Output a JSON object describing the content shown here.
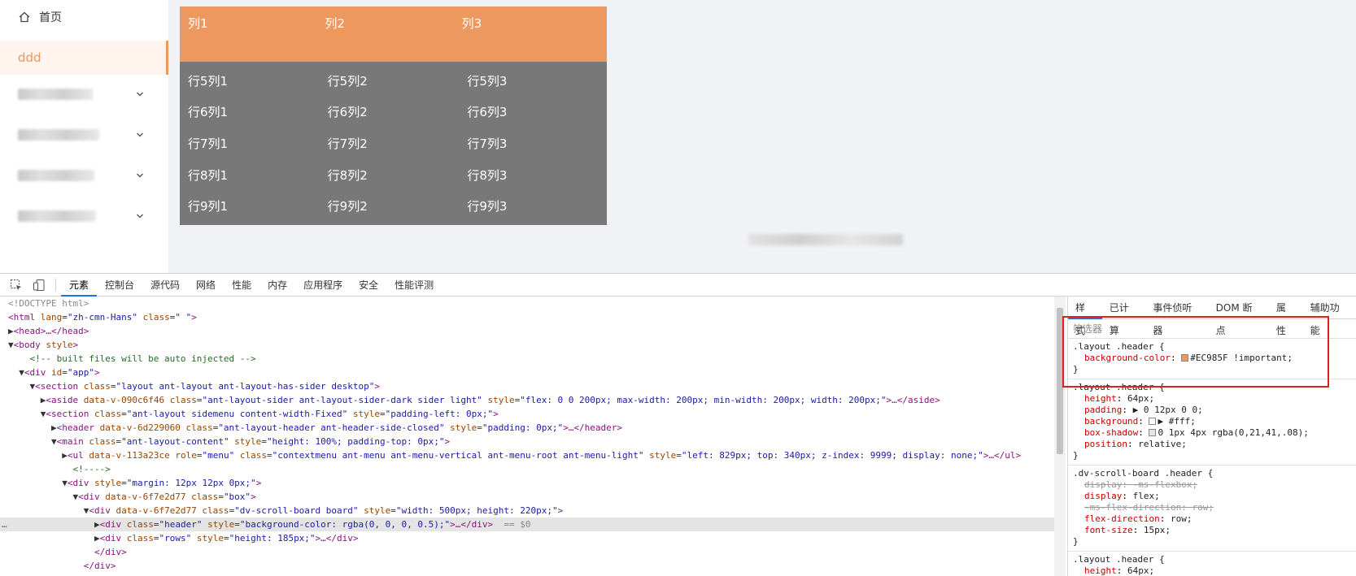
{
  "sider": {
    "home_label": "首页",
    "selected_label": "ddd",
    "submenus": [
      {
        "label": ""
      },
      {
        "label": ""
      },
      {
        "label": ""
      },
      {
        "label": ""
      }
    ]
  },
  "board": {
    "header_color": "#EC985F",
    "rows_color": "#787878",
    "columns": [
      "列1",
      "列2",
      "列3"
    ],
    "rows": [
      [
        "行5列1",
        "行5列2",
        "行5列3"
      ],
      [
        "行6列1",
        "行6列2",
        "行6列3"
      ],
      [
        "行7列1",
        "行7列2",
        "行7列3"
      ],
      [
        "行8列1",
        "行8列2",
        "行8列3"
      ],
      [
        "行9列1",
        "行9列2",
        "行9列3"
      ]
    ]
  },
  "devtools": {
    "tabs": [
      "元素",
      "控制台",
      "源代码",
      "网络",
      "性能",
      "内存",
      "应用程序",
      "安全",
      "性能评测"
    ],
    "active_tab": "元素",
    "style_tabs": [
      "样式",
      "已计算",
      "事件侦听器",
      "DOM 断点",
      "属性",
      "辅助功能"
    ],
    "filter_placeholder": "筛选器",
    "dom_lines": [
      "<!DOCTYPE html>",
      "<html lang=\"zh-cmn-Hans\" class=\" \">",
      "▶<head>…</head>",
      "▼<body style>",
      "    <!-- built files will be auto injected -->",
      "  ▼<div id=\"app\">",
      "    ▼<section class=\"layout ant-layout ant-layout-has-sider desktop\">",
      "      ▶<aside data-v-090c6f46 class=\"ant-layout-sider ant-layout-sider-dark sider light\" style=\"flex: 0 0 200px; max-width: 200px; min-width: 200px; width: 200px;\">…</aside>",
      "      ▼<section class=\"ant-layout sidemenu content-width-Fixed\" style=\"padding-left: 0px;\">",
      "        ▶<header data-v-6d229060 class=\"ant-layout-header ant-header-side-closed\" style=\"padding: 0px;\">…</header>",
      "        ▼<main class=\"ant-layout-content\" style=\"height: 100%; padding-top: 0px;\">",
      "          ▶<ul data-v-113a23ce role=\"menu\" class=\"contextmenu ant-menu ant-menu-vertical ant-menu-root ant-menu-light\" style=\"left: 829px; top: 340px; z-index: 9999; display: none;\">…</ul>",
      "            <!---->",
      "          ▼<div style=\"margin: 12px 12px 0px;\">",
      "            ▼<div data-v-6f7e2d77 class=\"box\">",
      "              ▼<div data-v-6f7e2d77 class=\"dv-scroll-board board\" style=\"width: 500px; height: 220px;\">",
      "                ▶<div class=\"header\" style=\"background-color: rgba(0, 0, 0, 0.5);\">…</div> == $0",
      "                ▶<div class=\"rows\" style=\"height: 185px;\">…</div>",
      "                </div>",
      "              </div>"
    ],
    "selected_line_index": 16,
    "rules": [
      {
        "selector": ".layout .header {",
        "props": [
          {
            "name": "background-color",
            "value": "#EC985F !important;",
            "swatch": "#EC985F"
          }
        ]
      },
      {
        "selector": ".layout .header {",
        "props": [
          {
            "name": "height",
            "value": "64px;"
          },
          {
            "name": "padding",
            "value": "▶ 0 12px 0 0;"
          },
          {
            "name": "background",
            "value": "▶ #fff;",
            "swatch": "#ffffff"
          },
          {
            "name": "box-shadow",
            "value": "0 1px 4px rgba(0,21,41,.08);",
            "swatch": "#e6e6e6"
          },
          {
            "name": "position",
            "value": "relative;"
          }
        ]
      },
      {
        "selector": ".dv-scroll-board .header {",
        "props": [
          {
            "name": "display",
            "value": "-ms-flexbox;",
            "struck": true
          },
          {
            "name": "display",
            "value": "flex;"
          },
          {
            "name": "-ms-flex-direction",
            "value": "row;",
            "struck": true
          },
          {
            "name": "flex-direction",
            "value": "row;"
          },
          {
            "name": "font-size",
            "value": "15px;"
          }
        ]
      },
      {
        "selector": ".layout .header {",
        "props": [
          {
            "name": "height",
            "value": "64px;"
          }
        ]
      }
    ]
  }
}
